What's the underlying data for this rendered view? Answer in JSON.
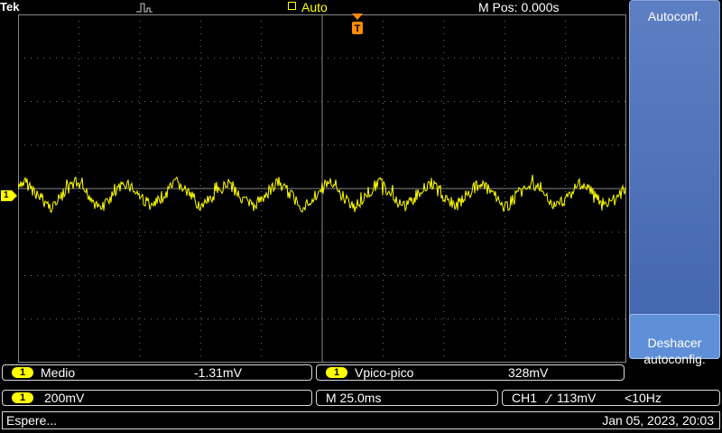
{
  "header": {
    "brand": "Tek",
    "trigger_mode": "Auto",
    "m_pos": "M Pos: 0.000s"
  },
  "channel_marker": "1",
  "sidebar": {
    "autoconf": "Autoconf.",
    "undo_line1": "Deshacer",
    "undo_line2": "autoconfig."
  },
  "measurements": [
    {
      "channel": "1",
      "label": "Medio",
      "value": "-1.31mV"
    },
    {
      "channel": "1",
      "label": "Vpico-pico",
      "value": "328mV"
    }
  ],
  "readouts": {
    "channel": "1",
    "volts_div": "200mV",
    "timebase": "M 25.0ms",
    "trigger_src": "CH1",
    "trigger_slope_icon": "rising-edge-icon",
    "trigger_level": "113mV",
    "freq": "<10Hz"
  },
  "status": {
    "message": "Espere...",
    "datetime": "Jan 05, 2023, 20:03"
  },
  "colors": {
    "trace": "#ffff00",
    "trigger_marker": "#ff8c00",
    "panel_blue": "#4f74bb",
    "grid": "#7a7a7a"
  }
}
